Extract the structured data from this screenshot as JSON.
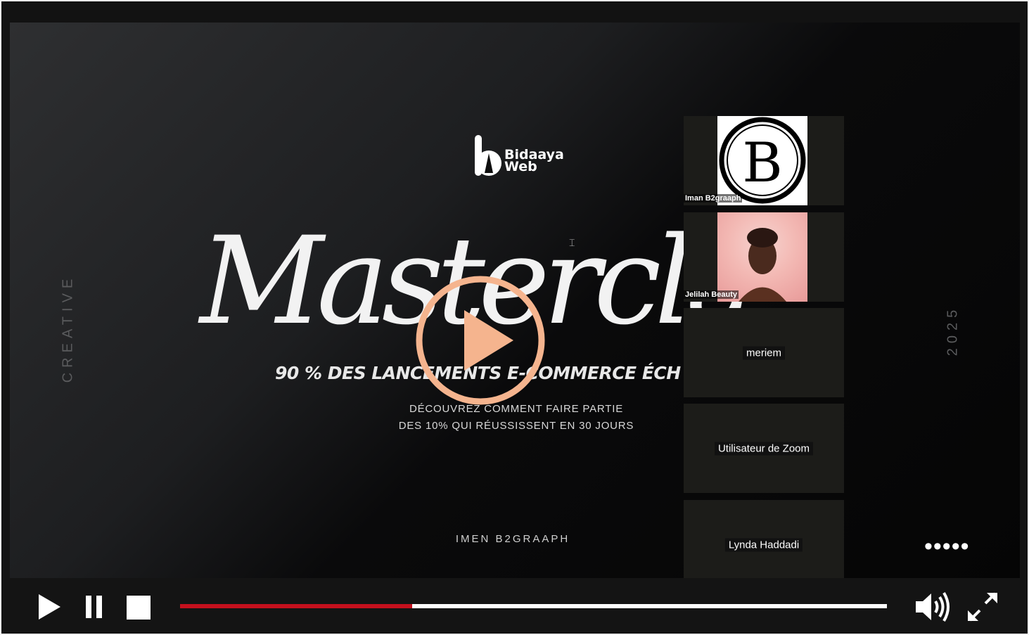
{
  "slide": {
    "logo_text": "Bidaaya\nWeb",
    "title": "Mastercla",
    "subtitle": "90  % DES LANCEMENTS E-COMMERCE ÉCH",
    "desc_line1": "DÉCOUVREZ COMMENT FAIRE PARTIE",
    "desc_line2": "DES 10% QUI RÉUSSISSENT EN 30 JOURS",
    "author": "IMEN B2GRAAPH",
    "side_left": "CREATIVE",
    "side_right": "2025"
  },
  "participants": [
    {
      "name": "Iman B2graaph"
    },
    {
      "name": "Jelilah Beauty"
    },
    {
      "name": "meriem"
    },
    {
      "name": "Utilisateur de Zoom"
    },
    {
      "name": "Lynda Haddadi"
    }
  ],
  "more_label": "•••••",
  "player": {
    "progress": 0.328,
    "accent": "#c4101d",
    "play_overlay_color": "#f5b48e"
  }
}
